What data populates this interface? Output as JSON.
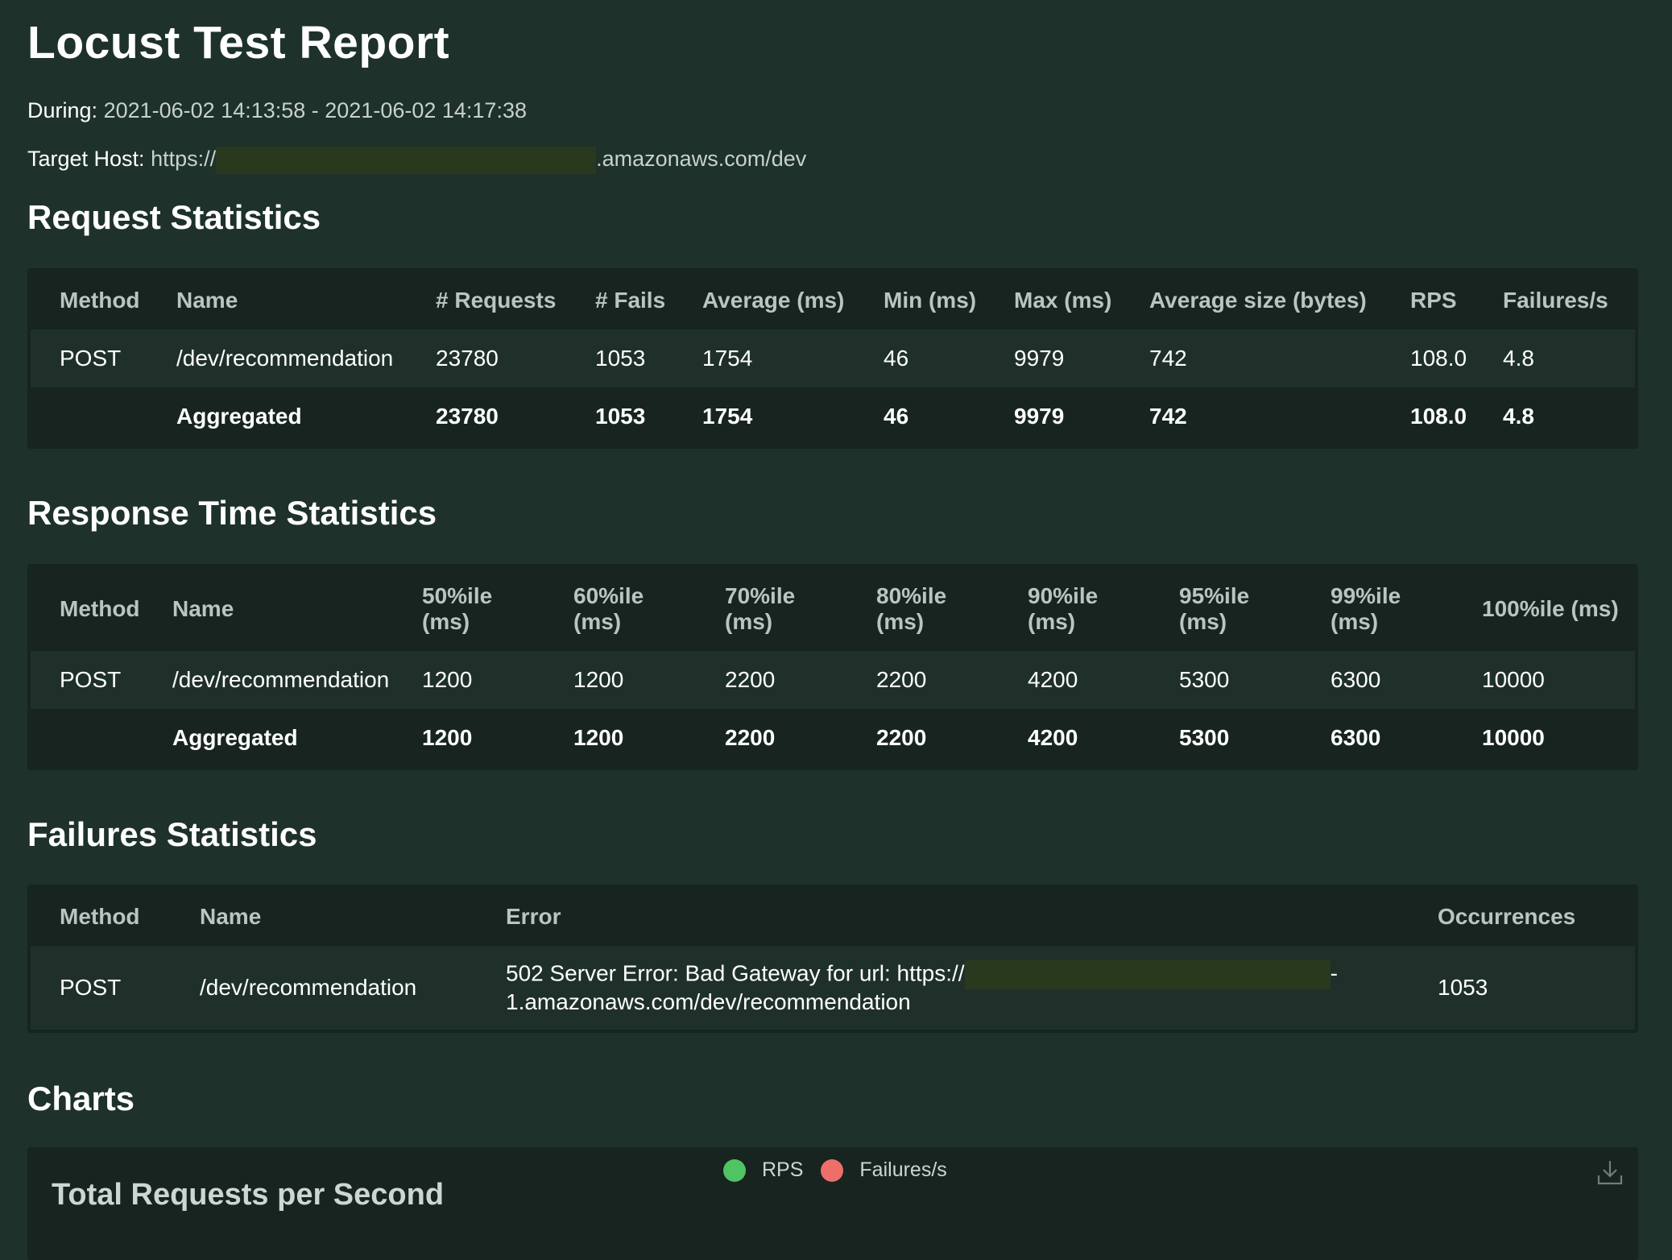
{
  "report": {
    "title": "Locust Test Report",
    "during_label": "During:",
    "during_value": "2021-06-02 14:13:58 - 2021-06-02 14:17:38",
    "host_label": "Target Host:",
    "host_prefix": "https://",
    "host_suffix": ".amazonaws.com/dev"
  },
  "request_stats": {
    "heading": "Request Statistics",
    "columns": [
      "Method",
      "Name",
      "# Requests",
      "# Fails",
      "Average (ms)",
      "Min (ms)",
      "Max (ms)",
      "Average size (bytes)",
      "RPS",
      "Failures/s"
    ],
    "rows": [
      [
        "POST",
        "/dev/recommendation",
        "23780",
        "1053",
        "1754",
        "46",
        "9979",
        "742",
        "108.0",
        "4.8"
      ]
    ],
    "aggregated": [
      "",
      "Aggregated",
      "23780",
      "1053",
      "1754",
      "46",
      "9979",
      "742",
      "108.0",
      "4.8"
    ]
  },
  "response_stats": {
    "heading": "Response Time Statistics",
    "columns": [
      "Method",
      "Name",
      "50%ile (ms)",
      "60%ile (ms)",
      "70%ile (ms)",
      "80%ile (ms)",
      "90%ile (ms)",
      "95%ile (ms)",
      "99%ile (ms)",
      "100%ile (ms)"
    ],
    "rows": [
      [
        "POST",
        "/dev/recommendation",
        "1200",
        "1200",
        "2200",
        "2200",
        "4200",
        "5300",
        "6300",
        "10000"
      ]
    ],
    "aggregated": [
      "",
      "Aggregated",
      "1200",
      "1200",
      "2200",
      "2200",
      "4200",
      "5300",
      "6300",
      "10000"
    ]
  },
  "failure_stats": {
    "heading": "Failures Statistics",
    "columns": [
      "Method",
      "Name",
      "Error",
      "Occurrences"
    ],
    "row": {
      "method": "POST",
      "name": "/dev/recommendation",
      "error_prefix": "502 Server Error: Bad Gateway for url: https://",
      "error_dash": "-",
      "error_suffix": "1.amazonaws.com/dev/recommendation",
      "occurrences": "1053"
    }
  },
  "charts": {
    "heading": "Charts",
    "title": "Total Requests per Second",
    "legend": [
      {
        "label": "RPS",
        "color": "#4fc463"
      },
      {
        "label": "Failures/s",
        "color": "#ee6e6a"
      }
    ],
    "download_icon": "download-icon"
  }
}
